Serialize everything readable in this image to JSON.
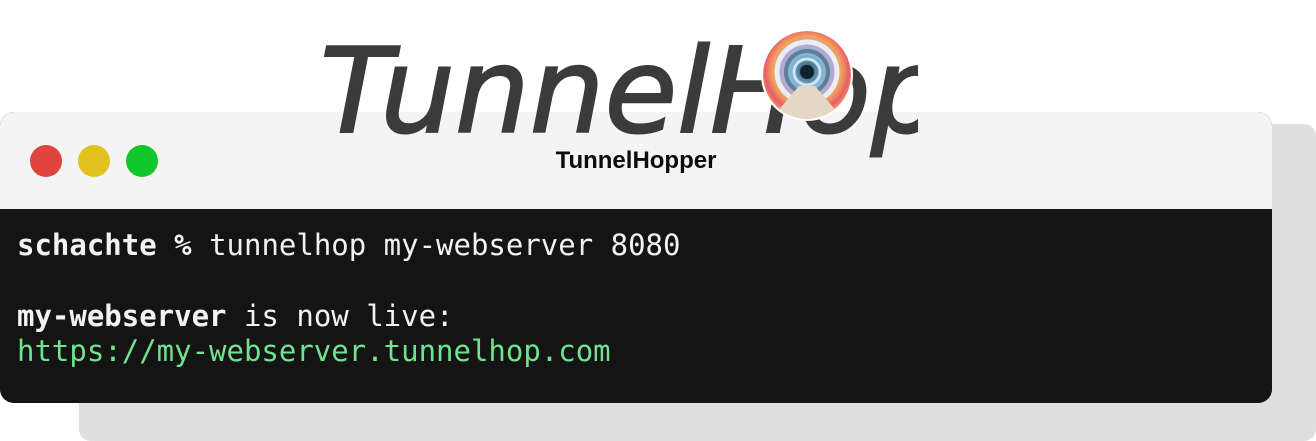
{
  "logo": {
    "wordmark": "TunnelHop",
    "emblem_icon": "rainbow-tunnel-icon",
    "color": "#3b3b3b"
  },
  "window": {
    "title": "TunnelHopper",
    "controls": {
      "close_color": "#e0443e",
      "minimize_color": "#e3c21f",
      "maximize_color": "#12c72a"
    }
  },
  "terminal": {
    "prompt_user": "schachte",
    "prompt_symbol": " %",
    "command": " tunnelhop my-webserver 8080",
    "server_name": "my-webserver",
    "status_text": " is now live:",
    "url": "https://my-webserver.tunnelhop.com",
    "background": "#141414",
    "url_color": "#6fe38e"
  }
}
